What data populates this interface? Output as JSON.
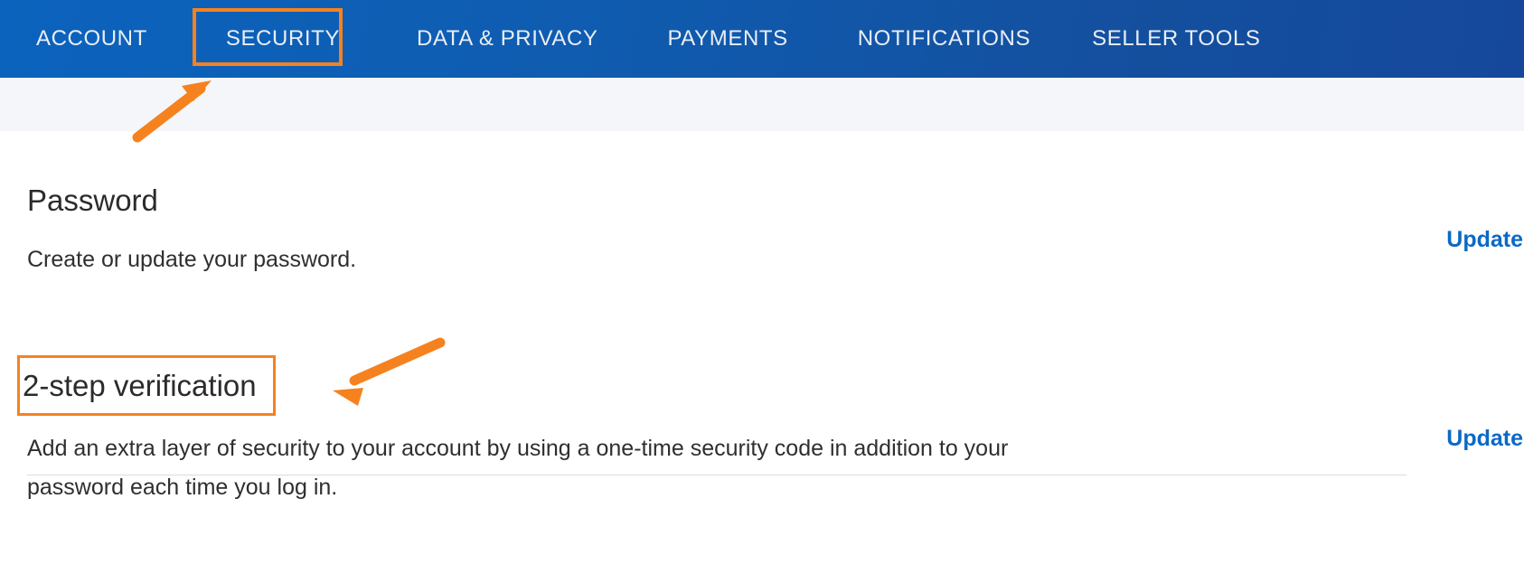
{
  "nav": {
    "items": [
      {
        "label": "ACCOUNT",
        "name": "nav-tab-account"
      },
      {
        "label": "SECURITY",
        "name": "nav-tab-security"
      },
      {
        "label": "DATA & PRIVACY",
        "name": "nav-tab-data-privacy"
      },
      {
        "label": "PAYMENTS",
        "name": "nav-tab-payments"
      },
      {
        "label": "NOTIFICATIONS",
        "name": "nav-tab-notifications"
      },
      {
        "label": "SELLER TOOLS",
        "name": "nav-tab-seller-tools"
      }
    ],
    "active_tab": "SECURITY",
    "background_start": "#0b63bd",
    "background_end": "#15489b",
    "text_color": "#e9eef6",
    "caret_color": "#1f63ae"
  },
  "annotations": {
    "highlight_color": "#f5821f",
    "arrow_color": "#f5821f",
    "boxes": [
      {
        "target": "SECURITY",
        "name": "annotation-box-security"
      },
      {
        "target": "2-step verification",
        "name": "annotation-box-2-step-verification"
      }
    ],
    "arrows": [
      {
        "points_to": "SECURITY",
        "name": "annotation-arrow-security"
      },
      {
        "points_to": "2-step verification",
        "name": "annotation-arrow-2-step-verification"
      }
    ]
  },
  "sections": {
    "password": {
      "title": "Password",
      "description": "Create or update your password.",
      "action_label": "Update"
    },
    "two_step": {
      "title": "2-step verification",
      "description": "Add an extra layer of security to your account by using a one-time security code in addition to your password each time you log in.",
      "action_label": "Update"
    }
  },
  "colors": {
    "link": "#0b69c7",
    "body_text": "#2f2f2f",
    "heading_text": "#2b2b2b",
    "subband": "#f4f6fa",
    "divider": "#dcdcdc"
  }
}
